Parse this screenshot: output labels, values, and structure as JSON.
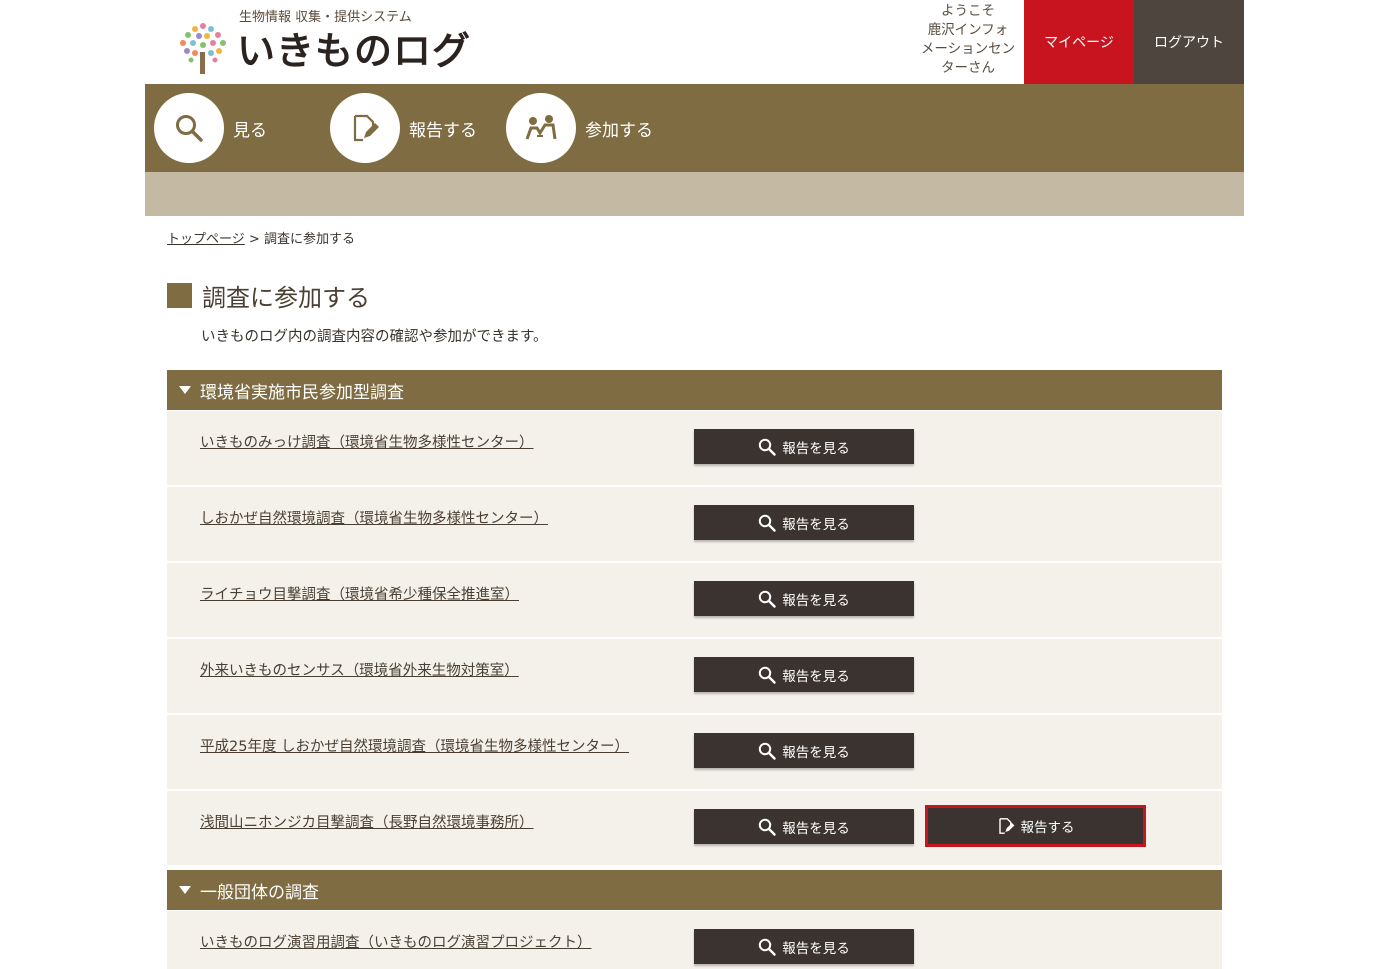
{
  "header": {
    "logo_subtitle": "生物情報 収集・提供システム",
    "logo_title": "いきものログ",
    "welcome_line1": "ようこそ",
    "welcome_line2": "鹿沢インフォ",
    "welcome_line3": "メーションセン",
    "welcome_line4": "ターさん",
    "mypage_label": "マイページ",
    "logout_label": "ログアウト"
  },
  "nav": {
    "items": [
      {
        "label": "見る",
        "icon": "search-icon"
      },
      {
        "label": "報告する",
        "icon": "report-icon"
      },
      {
        "label": "参加する",
        "icon": "participate-icon"
      }
    ]
  },
  "breadcrumb": {
    "home": "トップページ",
    "separator": ">",
    "current": "調査に参加する"
  },
  "page": {
    "title": "調査に参加する",
    "lead": "いきものログ内の調査内容の確認や参加ができます。"
  },
  "sections": [
    {
      "title": "環境省実施市民参加型調査",
      "rows": [
        {
          "name": "いきものみっけ調査（環境省生物多様性センター）",
          "view_label": "報告を見る"
        },
        {
          "name": "しおかぜ自然環境調査（環境省生物多様性センター）",
          "view_label": "報告を見る"
        },
        {
          "name": "ライチョウ目撃調査（環境省希少種保全推進室）",
          "view_label": "報告を見る"
        },
        {
          "name": "外来いきものセンサス（環境省外来生物対策室）",
          "view_label": "報告を見る"
        },
        {
          "name": "平成25年度 しおかぜ自然環境調査（環境省生物多様性センター）",
          "view_label": "報告を見る"
        },
        {
          "name": "浅間山ニホンジカ目撃調査（長野自然環境事務所）",
          "view_label": "報告を見る",
          "report_label": "報告する"
        }
      ]
    },
    {
      "title": "一般団体の調査",
      "rows": [
        {
          "name": "いきものログ演習用調査（いきものログ演習プロジェクト）",
          "view_label": "報告を見る"
        }
      ]
    }
  ],
  "colors": {
    "brand_brown": "#7f6c42",
    "subbar": "#c4b9a2",
    "mypage_red": "#c8141e",
    "logout_dark": "#4d453e",
    "button_dark": "#3b3330",
    "row_bg": "#f4f1ea"
  }
}
